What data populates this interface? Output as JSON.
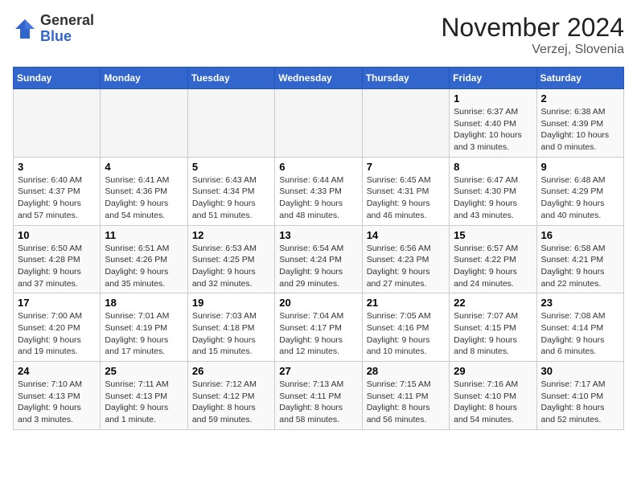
{
  "logo": {
    "general": "General",
    "blue": "Blue"
  },
  "title": "November 2024",
  "location": "Verzej, Slovenia",
  "days_of_week": [
    "Sunday",
    "Monday",
    "Tuesday",
    "Wednesday",
    "Thursday",
    "Friday",
    "Saturday"
  ],
  "weeks": [
    [
      {
        "day": "",
        "info": ""
      },
      {
        "day": "",
        "info": ""
      },
      {
        "day": "",
        "info": ""
      },
      {
        "day": "",
        "info": ""
      },
      {
        "day": "",
        "info": ""
      },
      {
        "day": "1",
        "info": "Sunrise: 6:37 AM\nSunset: 4:40 PM\nDaylight: 10 hours and 3 minutes."
      },
      {
        "day": "2",
        "info": "Sunrise: 6:38 AM\nSunset: 4:39 PM\nDaylight: 10 hours and 0 minutes."
      }
    ],
    [
      {
        "day": "3",
        "info": "Sunrise: 6:40 AM\nSunset: 4:37 PM\nDaylight: 9 hours and 57 minutes."
      },
      {
        "day": "4",
        "info": "Sunrise: 6:41 AM\nSunset: 4:36 PM\nDaylight: 9 hours and 54 minutes."
      },
      {
        "day": "5",
        "info": "Sunrise: 6:43 AM\nSunset: 4:34 PM\nDaylight: 9 hours and 51 minutes."
      },
      {
        "day": "6",
        "info": "Sunrise: 6:44 AM\nSunset: 4:33 PM\nDaylight: 9 hours and 48 minutes."
      },
      {
        "day": "7",
        "info": "Sunrise: 6:45 AM\nSunset: 4:31 PM\nDaylight: 9 hours and 46 minutes."
      },
      {
        "day": "8",
        "info": "Sunrise: 6:47 AM\nSunset: 4:30 PM\nDaylight: 9 hours and 43 minutes."
      },
      {
        "day": "9",
        "info": "Sunrise: 6:48 AM\nSunset: 4:29 PM\nDaylight: 9 hours and 40 minutes."
      }
    ],
    [
      {
        "day": "10",
        "info": "Sunrise: 6:50 AM\nSunset: 4:28 PM\nDaylight: 9 hours and 37 minutes."
      },
      {
        "day": "11",
        "info": "Sunrise: 6:51 AM\nSunset: 4:26 PM\nDaylight: 9 hours and 35 minutes."
      },
      {
        "day": "12",
        "info": "Sunrise: 6:53 AM\nSunset: 4:25 PM\nDaylight: 9 hours and 32 minutes."
      },
      {
        "day": "13",
        "info": "Sunrise: 6:54 AM\nSunset: 4:24 PM\nDaylight: 9 hours and 29 minutes."
      },
      {
        "day": "14",
        "info": "Sunrise: 6:56 AM\nSunset: 4:23 PM\nDaylight: 9 hours and 27 minutes."
      },
      {
        "day": "15",
        "info": "Sunrise: 6:57 AM\nSunset: 4:22 PM\nDaylight: 9 hours and 24 minutes."
      },
      {
        "day": "16",
        "info": "Sunrise: 6:58 AM\nSunset: 4:21 PM\nDaylight: 9 hours and 22 minutes."
      }
    ],
    [
      {
        "day": "17",
        "info": "Sunrise: 7:00 AM\nSunset: 4:20 PM\nDaylight: 9 hours and 19 minutes."
      },
      {
        "day": "18",
        "info": "Sunrise: 7:01 AM\nSunset: 4:19 PM\nDaylight: 9 hours and 17 minutes."
      },
      {
        "day": "19",
        "info": "Sunrise: 7:03 AM\nSunset: 4:18 PM\nDaylight: 9 hours and 15 minutes."
      },
      {
        "day": "20",
        "info": "Sunrise: 7:04 AM\nSunset: 4:17 PM\nDaylight: 9 hours and 12 minutes."
      },
      {
        "day": "21",
        "info": "Sunrise: 7:05 AM\nSunset: 4:16 PM\nDaylight: 9 hours and 10 minutes."
      },
      {
        "day": "22",
        "info": "Sunrise: 7:07 AM\nSunset: 4:15 PM\nDaylight: 9 hours and 8 minutes."
      },
      {
        "day": "23",
        "info": "Sunrise: 7:08 AM\nSunset: 4:14 PM\nDaylight: 9 hours and 6 minutes."
      }
    ],
    [
      {
        "day": "24",
        "info": "Sunrise: 7:10 AM\nSunset: 4:13 PM\nDaylight: 9 hours and 3 minutes."
      },
      {
        "day": "25",
        "info": "Sunrise: 7:11 AM\nSunset: 4:13 PM\nDaylight: 9 hours and 1 minute."
      },
      {
        "day": "26",
        "info": "Sunrise: 7:12 AM\nSunset: 4:12 PM\nDaylight: 8 hours and 59 minutes."
      },
      {
        "day": "27",
        "info": "Sunrise: 7:13 AM\nSunset: 4:11 PM\nDaylight: 8 hours and 58 minutes."
      },
      {
        "day": "28",
        "info": "Sunrise: 7:15 AM\nSunset: 4:11 PM\nDaylight: 8 hours and 56 minutes."
      },
      {
        "day": "29",
        "info": "Sunrise: 7:16 AM\nSunset: 4:10 PM\nDaylight: 8 hours and 54 minutes."
      },
      {
        "day": "30",
        "info": "Sunrise: 7:17 AM\nSunset: 4:10 PM\nDaylight: 8 hours and 52 minutes."
      }
    ]
  ]
}
